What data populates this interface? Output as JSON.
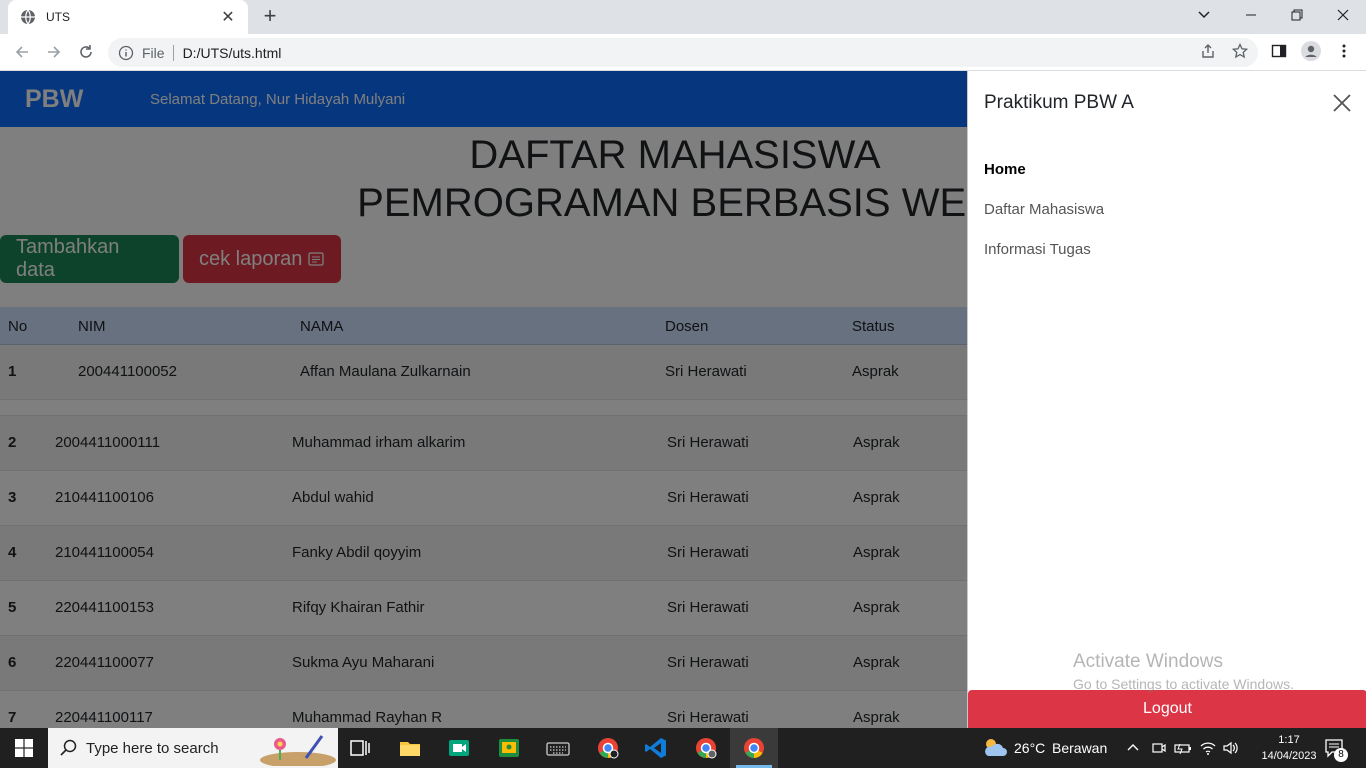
{
  "browser": {
    "tab_title": "UTS",
    "url_scheme": "File",
    "url": "D:/UTS/uts.html"
  },
  "navbar": {
    "brand": "PBW",
    "welcome": "Selamat Datang, Nur Hidayah Mulyani"
  },
  "heading": {
    "line1": "DAFTAR MAHASISWA",
    "line2": "PEMROGRAMAN BERBASIS WEB"
  },
  "actions": {
    "add_label": "Tambahkan data",
    "report_label": "cek laporan"
  },
  "table": {
    "headers": [
      "No",
      "NIM",
      "NAMA",
      "Dosen",
      "Status"
    ],
    "rows": [
      {
        "no": "1",
        "nim": "200441100052",
        "nama": "Affan Maulana Zulkarnain",
        "dosen": "Sri Herawati",
        "status": "Asprak"
      },
      {
        "no": "2",
        "nim": "2004411000111",
        "nama": "Muhammad irham alkarim",
        "dosen": "Sri Herawati",
        "status": "Asprak"
      },
      {
        "no": "3",
        "nim": "210441100106",
        "nama": "Abdul wahid",
        "dosen": "Sri Herawati",
        "status": "Asprak"
      },
      {
        "no": "4",
        "nim": "210441100054",
        "nama": "Fanky Abdil qoyyim",
        "dosen": "Sri Herawati",
        "status": "Asprak"
      },
      {
        "no": "5",
        "nim": "220441100153",
        "nama": "Rifqy Khairan Fathir",
        "dosen": "Sri Herawati",
        "status": "Asprak"
      },
      {
        "no": "6",
        "nim": "220441100077",
        "nama": "Sukma Ayu Maharani",
        "dosen": "Sri Herawati",
        "status": "Asprak"
      },
      {
        "no": "7",
        "nim": "220441100117",
        "nama": "Muhammad Rayhan R",
        "dosen": "Sri Herawati",
        "status": "Asprak"
      }
    ]
  },
  "offcanvas": {
    "title": "Praktikum PBW A",
    "links": [
      {
        "label": "Home",
        "active": true
      },
      {
        "label": "Daftar Mahasiswa",
        "active": false
      },
      {
        "label": "Informasi Tugas",
        "active": false
      }
    ],
    "logout_label": "Logout"
  },
  "watermark": {
    "line1": "Activate Windows",
    "line2": "Go to Settings to activate Windows."
  },
  "taskbar": {
    "search_placeholder": "Type here to search",
    "weather_temp": "26°C",
    "weather_desc": "Berawan",
    "time": "1:17",
    "date": "14/04/2023",
    "notification_count": "8"
  },
  "colors": {
    "primary": "#0d6efd",
    "success": "#198754",
    "danger": "#dc3545",
    "table_head": "#cfe2ff"
  }
}
